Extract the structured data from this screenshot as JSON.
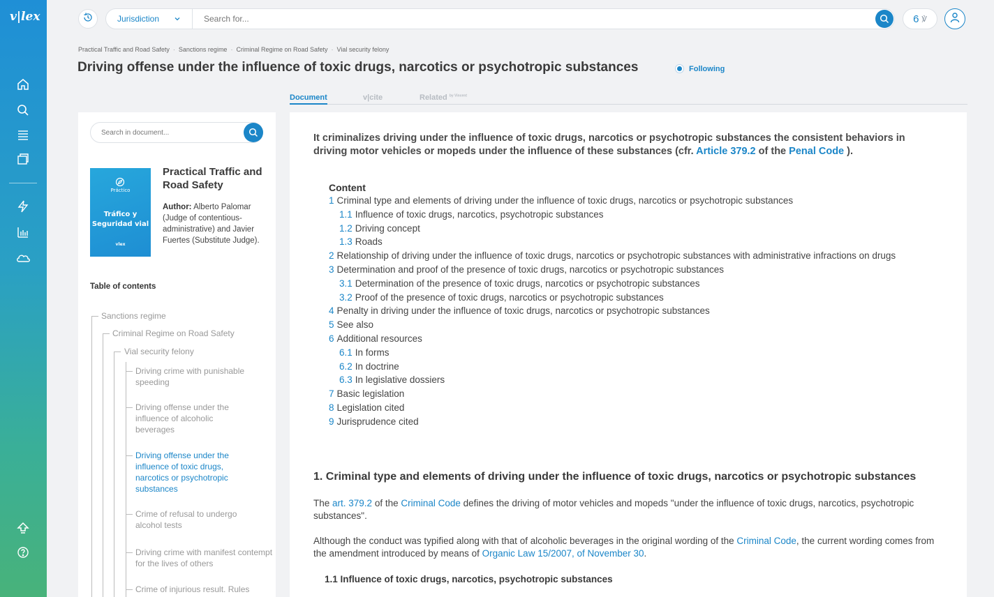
{
  "app": {
    "logo": "v|lex"
  },
  "sidebar": {
    "items": [
      "home-icon",
      "search-icon",
      "list-icon",
      "folder-icon",
      "bolt-icon",
      "chart-icon",
      "cloud-icon",
      "upload-icon",
      "help-icon"
    ]
  },
  "topbar": {
    "jurisdiction_label": "Jurisdiction",
    "search_placeholder": "Search for...",
    "credits_count": "6",
    "credits_symbol": "℣"
  },
  "breadcrumb": [
    "Practical Traffic and Road Safety",
    "Sanctions regime",
    "Criminal Regime on Road Safety",
    "Vial security felony"
  ],
  "page": {
    "title": "Driving offense under the influence of toxic drugs, narcotics or psychotropic substances",
    "following_label": "Following"
  },
  "tabs": {
    "document": "Document",
    "vcite": "v|cite",
    "related": "Related",
    "related_by": "by Vincent"
  },
  "left": {
    "search_placeholder": "Search in document...",
    "cover": {
      "series": "Práctico",
      "title_line1": "Tráfico y",
      "title_line2": "Seguridad vial",
      "brand": "vlex"
    },
    "book_title": "Practical Traffic and Road Safety",
    "author_label": "Author:",
    "author_text": "Alberto Palomar (Judge of contentious-administrative) and Javier Fuertes (Substitute Judge).",
    "toc_heading": "Table of contents",
    "tree": {
      "l1": "Sanctions regime",
      "l2": "Criminal Regime on Road Safety",
      "l3": "Vial security felony",
      "items": [
        "Driving crime with punishable speeding",
        "Driving offense under the influence of alcoholic beverages",
        "Driving offense under the influence of toxic drugs, narcotics or psychotropic substances",
        "Crime of refusal to undergo alcohol tests",
        "Driving crime with manifest contempt for the lives of others",
        "Crime of injurious result. Rules"
      ]
    }
  },
  "doc": {
    "intro_a": "It criminalizes driving under the influence of toxic drugs, narcotics or psychotropic substances the consistent behaviors in driving motor vehicles or mopeds under the influence of these substances (cfr. ",
    "intro_link1": "Article 379.2",
    "intro_b": " of the ",
    "intro_link2": "Penal Code",
    "intro_c": " ).",
    "contents_heading": "Content",
    "contents": [
      {
        "n": "1",
        "t": "Criminal type and elements of driving under the influence of toxic drugs, narcotics or psychotropic substances",
        "sub": false
      },
      {
        "n": "1.1",
        "t": "Influence of toxic drugs, narcotics, psychotropic substances",
        "sub": true
      },
      {
        "n": "1.2",
        "t": "Driving concept",
        "sub": true
      },
      {
        "n": "1.3",
        "t": "Roads",
        "sub": true
      },
      {
        "n": "2",
        "t": "Relationship of driving under the influence of toxic drugs, narcotics or psychotropic substances with administrative infractions on drugs",
        "sub": false
      },
      {
        "n": "3",
        "t": "Determination and proof of the presence of toxic drugs, narcotics or psychotropic substances",
        "sub": false
      },
      {
        "n": "3.1",
        "t": "Determination of the presence of toxic drugs, narcotics or psychotropic substances",
        "sub": true
      },
      {
        "n": "3.2",
        "t": "Proof of the presence of toxic drugs, narcotics or psychotropic substances",
        "sub": true
      },
      {
        "n": "4",
        "t": "Penalty in driving under the influence of toxic drugs, narcotics or psychotropic substances",
        "sub": false
      },
      {
        "n": "5",
        "t": "See also",
        "sub": false
      },
      {
        "n": "6",
        "t": "Additional resources",
        "sub": false
      },
      {
        "n": "6.1",
        "t": "In forms",
        "sub": true
      },
      {
        "n": "6.2",
        "t": "In doctrine",
        "sub": true
      },
      {
        "n": "6.3",
        "t": "In legislative dossiers",
        "sub": true
      },
      {
        "n": "7",
        "t": "Basic legislation",
        "sub": false
      },
      {
        "n": "8",
        "t": "Legislation cited",
        "sub": false
      },
      {
        "n": "9",
        "t": "Jurisprudence cited",
        "sub": false
      }
    ],
    "section1_title": "1. Criminal type and elements of driving under the influence of toxic drugs, narcotics or psychotropic substances",
    "p1_a": "The ",
    "p1_link1": "art. 379.2",
    "p1_b": " of the ",
    "p1_link2": "Criminal Code",
    "p1_c": " defines the driving of motor vehicles and mopeds \"under the influence of toxic drugs, narcotics, psychotropic substances\".",
    "p2_a": "Although the conduct was typified along with that of alcoholic beverages in the original wording of the ",
    "p2_link1": "Criminal Code",
    "p2_b": ", the current wording comes from the amendment introduced by means of ",
    "p2_link2": "Organic Law 15/2007, of November 30",
    "p2_c": ".",
    "section11_title": "1.1 Influence of toxic drugs, narcotics, psychotropic substances"
  }
}
